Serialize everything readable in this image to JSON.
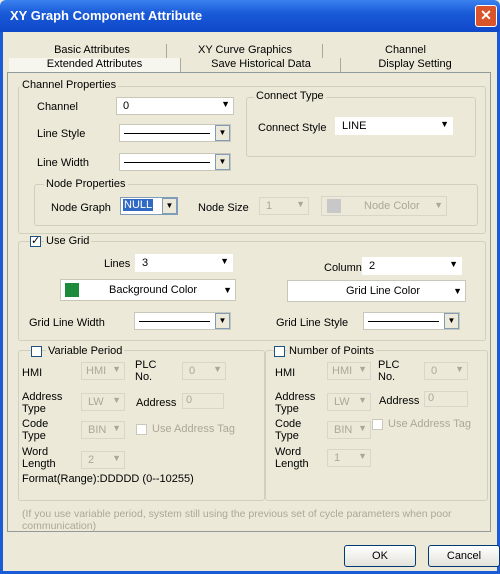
{
  "window": {
    "title": "XY Graph Component Attribute",
    "close": "✕"
  },
  "tabs_row1": [
    "Basic Attributes",
    "XY Curve Graphics",
    "Channel"
  ],
  "tabs_row2": [
    "Extended Attributes",
    "Save Historical Data",
    "Display Setting"
  ],
  "channel_props": {
    "group_label": "Channel Properties",
    "channel_label": "Channel",
    "channel_value": "0",
    "line_style_label": "Line Style",
    "line_width_label": "Line Width"
  },
  "connect_type": {
    "group_label": "Connect Type",
    "style_label": "Connect Style",
    "style_value": "LINE"
  },
  "node_props": {
    "group_label": "Node Properties",
    "graph_label": "Node Graph",
    "graph_value": "NULL",
    "size_label": "Node Size",
    "size_value": "1",
    "color_label": "Node Color"
  },
  "grid": {
    "check_label": "Use Grid",
    "checked": "✓",
    "lines_label": "Lines",
    "lines_value": "3",
    "columns_label": "Columns",
    "columns_value": "2",
    "bg_color_label": "Background Color",
    "bg_color": "#1e8a3c",
    "line_color_label": "Grid Line Color",
    "line_color": "#ffffff",
    "width_label": "Grid Line Width",
    "style_label": "Grid Line Style"
  },
  "variable_period": {
    "check_label": "Variable Period",
    "hmi_label": "HMI",
    "hmi_value": "HMI",
    "plc_label": "PLC\nNo.",
    "plc_value": "0",
    "addr_type_label": "Address\nType",
    "addr_type_value": "LW",
    "address_label": "Address",
    "address_value": "0",
    "code_type_label": "Code\nType",
    "code_type_value": "BIN",
    "use_tag_label": "Use Address Tag",
    "word_len_label": "Word\nLength",
    "word_len_value": "2",
    "format_text": "Format(Range):DDDDD (0--10255)"
  },
  "num_points": {
    "check_label": "Number of Points",
    "hmi_label": "HMI",
    "hmi_value": "HMI",
    "plc_label": "PLC\nNo.",
    "plc_value": "0",
    "addr_type_label": "Address\nType",
    "addr_type_value": "LW",
    "address_label": "Address",
    "address_value": "0",
    "code_type_label": "Code\nType",
    "code_type_value": "BIN",
    "use_tag_label": "Use Address Tag",
    "word_len_label": "Word\nLength",
    "word_len_value": "1"
  },
  "note": "(If you use variable period, system still using the previous set of cycle parameters when poor communication)",
  "buttons": {
    "ok": "OK",
    "cancel": "Cancel"
  }
}
